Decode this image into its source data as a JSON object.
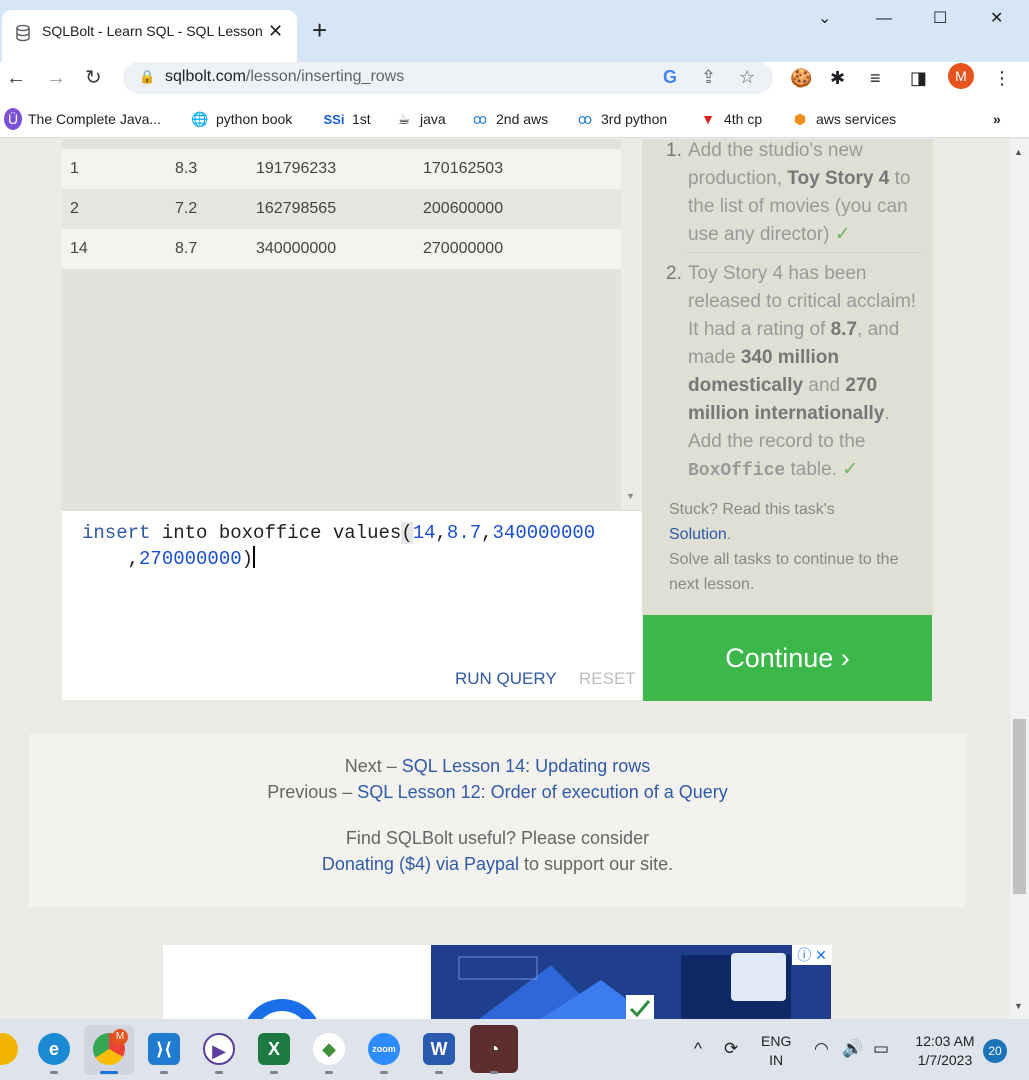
{
  "browser": {
    "tab_title": "SQLBolt - Learn SQL - SQL Lesson",
    "new_tab": "+",
    "url_host": "sqlbolt.com",
    "url_path": "/lesson/inserting_rows",
    "profile_initial": "M",
    "bookmarks": [
      {
        "label": "The Complete Java...",
        "icon": "java-course-icon"
      },
      {
        "label": "python book",
        "icon": "globe-icon"
      },
      {
        "label": "1st",
        "icon": "ssi-icon",
        "prefix": "SSi"
      },
      {
        "label": "java",
        "icon": "java-icon"
      },
      {
        "label": "2nd aws",
        "icon": "aws-icon"
      },
      {
        "label": "3rd python",
        "icon": "aws-icon"
      },
      {
        "label": "4th cp",
        "icon": "cp-icon"
      },
      {
        "label": "aws services",
        "icon": "aws-box-icon"
      }
    ],
    "bookmarks_overflow": "»"
  },
  "results": {
    "rows": [
      [
        "1",
        "8.3",
        "191796233",
        "170162503"
      ],
      [
        "2",
        "7.2",
        "162798565",
        "200600000"
      ],
      [
        "14",
        "8.7",
        "340000000",
        "270000000"
      ]
    ]
  },
  "editor": {
    "kw_insert": "insert",
    "word_into": " into ",
    "word_table": "boxoffice",
    "kw_values": " values",
    "open_paren": "(",
    "v1": "14",
    "v2": "8.7",
    "v3": "340000000",
    "v4": "270000000",
    "comma": ",",
    "close_paren": ")",
    "run_label": "RUN QUERY",
    "reset_label": "RESET"
  },
  "tasks": {
    "t1_num": "1.",
    "t1_a": "Add the studio's new production, ",
    "t1_b": "Toy Story 4",
    "t1_c": " to the list of movies (you can use any director)",
    "t2_num": "2.",
    "t2_a": "Toy Story 4 has been released to critical acclaim! It had a rating of ",
    "t2_b": "8.7",
    "t2_c": ", and made ",
    "t2_d": "340 million domestically",
    "t2_e": " and ",
    "t2_f": "270 million internationally",
    "t2_g": ". Add the record to the ",
    "t2_h": "BoxOffice",
    "t2_i": " table.",
    "check": "✓",
    "stuck_text": "Stuck? Read this task's",
    "solution_link": "Solution",
    "stuck_dot": ".",
    "solve_text": "Solve all tasks to continue to the next lesson.",
    "continue_label": "Continue ›"
  },
  "footer": {
    "next_prefix": "Next – ",
    "next_link": "SQL Lesson 14: Updating rows",
    "prev_prefix": "Previous – ",
    "prev_link": "SQL Lesson 12: Order of execution of a Query",
    "find_text": "Find SQLBolt useful? Please consider",
    "donate_link": "Donating ($4) via Paypal",
    "donate_suffix": " to support our site."
  },
  "taskbar": {
    "apps": [
      "edge-icon",
      "chrome-icon",
      "vscode-icon",
      "media-player-icon",
      "excel-icon",
      "mongodb-icon",
      "zoom-icon",
      "word-icon",
      "speedometer-icon"
    ],
    "chrome_badge": "M",
    "zoom_label": "zoom",
    "lang_top": "ENG",
    "lang_bottom": "IN",
    "time": "12:03 AM",
    "date": "1/7/2023",
    "notifications": "20"
  }
}
